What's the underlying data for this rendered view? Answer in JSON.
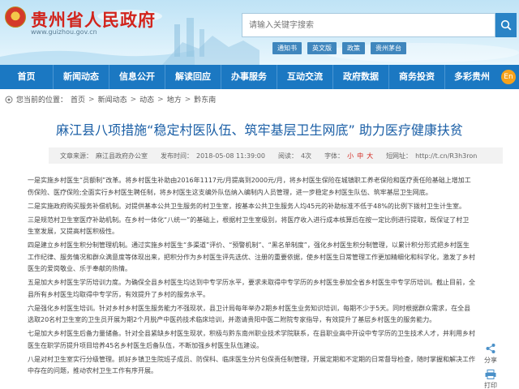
{
  "header": {
    "site_title": "贵州省人民政府",
    "site_url": "www.guizhou.gov.cn",
    "search": {
      "placeholder": "请输入关键字搜索",
      "value": ""
    },
    "quick_links": [
      "通知书",
      "英文版",
      "政策",
      "贵州茅台"
    ]
  },
  "nav": {
    "items": [
      "首页",
      "新闻动态",
      "信息公开",
      "解读回应",
      "办事服务",
      "互动交流",
      "政府数据",
      "商务投资",
      "多彩贵州"
    ],
    "lang": "En"
  },
  "breadcrumb": {
    "prefix": "您当前的位置：",
    "items": [
      "首页",
      "新闻动态",
      "动态",
      "地方",
      "黔东南"
    ]
  },
  "article": {
    "title": "麻江县八项措施“稳定村医队伍、筑牢基层卫生网底” 助力医疗健康扶贫",
    "meta": {
      "source_label": "文章来源：",
      "source": "麻江县政府办公室",
      "date_label": "发布时间：",
      "date": "2018-05-08 11:39:00",
      "views_label": "阅读：",
      "views": "4次",
      "font_label": "字体：",
      "font_small": "小",
      "font_medium": "中",
      "font_large": "大",
      "short_url_label": "短网址：",
      "short_url": "http://t.cn/R3h3ron"
    },
    "paragraphs": [
      "一是实施乡村医生“员额制”改革。将乡村医生补助由2016年1117元/月提高到2000元/月，将乡村医生保险在城镇职工养老保险和医疗责任险基础上增加工伤保险、医疗保险;全面实行乡村医生聘任制，将乡村医生这支编外队伍纳入编制内人员管理，进一步稳定乡村医生队伍、筑牢基层卫生网底。",
      "二是实施政府购买服务补偿机制。对提供基本公共卫生服务的村卫生室，按基本公共卫生服务人均45元的补助标准不低于48%的比例下拨村卫生计生室。",
      "三是规范村卫生室医疗补助机制。在乡村一体化“八统一”的基础上，根据村卫生室级别，将医疗收入进行成本核算后在按一定比例进行提取，既保证了村卫生室发展，又提高村医积极性。",
      "四是建立乡村医生积分制管理机制。通过实施乡村医生“多渠道”评价、“预警机制”、“黑名单制度”，强化乡村医生积分制管理，以累计积分形式把乡村医生工作纪律、服务情况和群众满意度等体现出来，把积分作为乡村医生评先选优、注册的重要依据，使乡村医生日常管理工作更加精细化和科学化，激发了乡村医生的爱岗敬业、乐于奉献的热情。",
      "五是加大乡村医生学历培训力度。为确保全县乡村医生均达到中专学历水平，要求未取得中专学历的乡村医生参加全省乡村医生中专学历培训。截止目前，全县所有乡村医生均取得中专学历，有效提升了乡村的服务水平。",
      "六是强化乡村医生培训。针对乡村乡村医生服务能力不强现状，县卫计局每年举办2期乡村医生业务知识培训，每期不少于5天。同时根据群众需求，在全县选取20名村卫生室的卫生员开展为期2个月脱产中医药技术临床培训，并邀请贵阳中医二附院专家指导，有效提升了基层乡村医生的服务能力。",
      "七是加大乡村医生后备力量储备。针对全县紧缺乡村医生现状，积极与黔东南州职业技术学院联系，在县职业高中开设中专学历的卫生技术人才，并利用乡村医生在职学历提升项目培养45名乡村医生后备队伍，不断加强乡村医生队伍建设。",
      "八是对村卫生室实行分级管理。抓好乡镇卫生院班子成员、防保科、临床医生分片包保责任制管理，开展定期和不定期的日常督导检查，随时掌握和解决工作中存在的问题，推动农村卫生工作有序开展。"
    ]
  },
  "side_tools": {
    "share": "分享",
    "print": "打印"
  },
  "colors": {
    "nav_blue": "#1b78c2",
    "title_red": "#d2241c",
    "title_blue": "#1b5fa6"
  }
}
